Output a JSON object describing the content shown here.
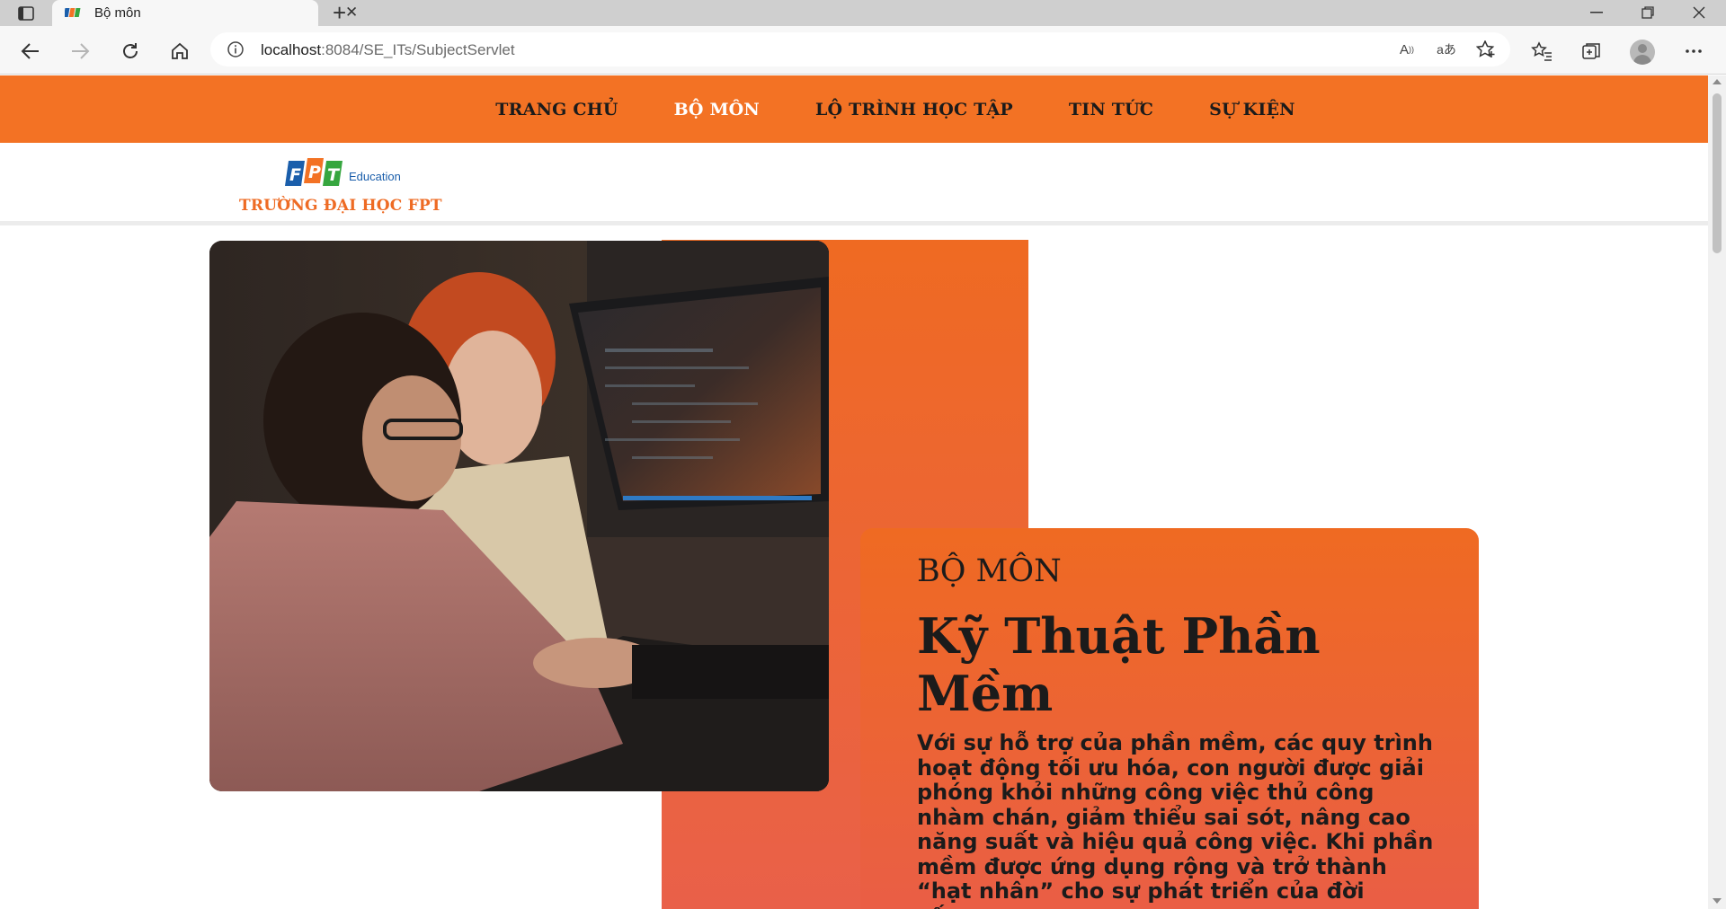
{
  "browser": {
    "tab_title": "Bộ môn",
    "url_host": "localhost",
    "url_path": ":8084/SE_ITs/SubjectServlet",
    "read_aloud_label": "A",
    "translate_label": "aあ"
  },
  "site": {
    "nav": [
      "TRANG CHỦ",
      "BỘ MÔN",
      "LỘ TRÌNH HỌC TẬP",
      "TIN TỨC",
      "SỰ KIỆN"
    ],
    "active_nav_index": 1,
    "logo_word": "FPT",
    "logo_tag": "Education",
    "school_name": "TRƯỜNG ĐẠI HỌC FPT"
  },
  "hero": {
    "kicker": "BỘ MÔN",
    "heading": "Kỹ Thuật Phần Mềm",
    "description": "Với sự hỗ trợ của phần mềm, các quy trình hoạt động tối ưu hóa, con người được giải phóng khỏi những công việc thủ công nhàm chán, giảm thiểu sai sót, nâng cao năng suất và hiệu quả công việc. Khi phần mềm được ứng dụng rộng và trở thành “hạt nhân” cho sự phát triển của đời sống,"
  },
  "colors": {
    "brand_orange": "#f37224",
    "nav_active": "#ffffff",
    "logo_blue": "#1a5eab",
    "logo_green": "#36a63f"
  },
  "icons": {
    "tab_actions": "tab-actions-icon",
    "favicon": "fpt-favicon",
    "back": "back-arrow-icon",
    "forward": "forward-arrow-icon",
    "refresh": "refresh-icon",
    "home": "home-icon",
    "info": "info-icon",
    "favorites": "favorites-icon",
    "collections": "collections-icon",
    "more": "more-icon"
  }
}
